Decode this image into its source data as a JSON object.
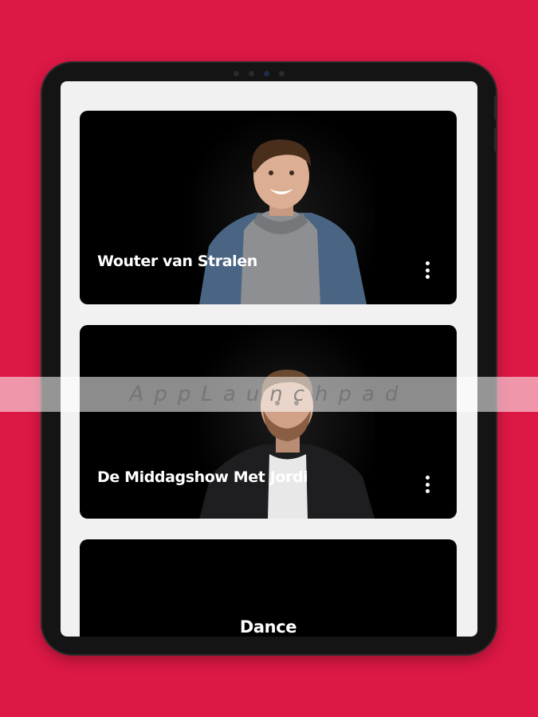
{
  "colors": {
    "background": "#dc1845",
    "device_frame": "#141414",
    "screen": "#f1f1f1",
    "card": "#000000",
    "text": "#ffffff"
  },
  "cards": [
    {
      "title": "Wouter van Stralen",
      "image": "presenter-portrait-man-denim-jacket-grey-hoodie",
      "menu_icon": "more-vertical-icon"
    },
    {
      "title": "De Middagshow Met Jordi",
      "image": "presenter-portrait-man-black-jacket-white-shirt",
      "menu_icon": "more-vertical-icon"
    },
    {
      "title": "Dance",
      "image": "",
      "menu_icon": ""
    }
  ],
  "watermark": {
    "text": "AppLaunchpad"
  }
}
